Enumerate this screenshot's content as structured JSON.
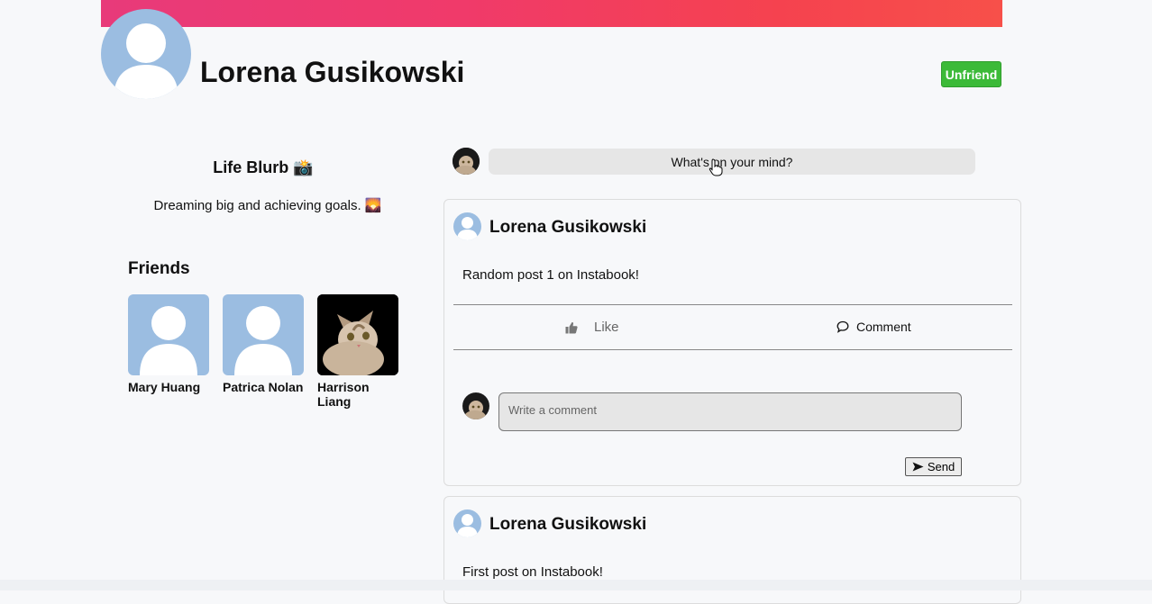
{
  "profile": {
    "name": "Lorena Gusikowski",
    "unfriend_label": "Unfriend"
  },
  "about": {
    "title": "Life Blurb 📸",
    "text": "Dreaming big and achieving goals. 🌄"
  },
  "friends": {
    "title": "Friends",
    "items": [
      {
        "name": "Mary Huang",
        "avatar": "default-person-icon"
      },
      {
        "name": "Patrica Nolan",
        "avatar": "default-person-icon"
      },
      {
        "name": "Harrison Liang",
        "avatar": "cat-photo"
      }
    ]
  },
  "composer": {
    "placeholder": "What's on your mind?"
  },
  "posts": [
    {
      "author": "Lorena Gusikowski",
      "text": "Random post 1 on Instabook!",
      "like_label": "Like",
      "comment_label": "Comment",
      "comment_placeholder": "Write a comment",
      "send_label": "Send"
    },
    {
      "author": "Lorena Gusikowski",
      "text": "First post on Instabook!"
    }
  ],
  "colors": {
    "accent_green": "#3cba38",
    "banner_pink": "#e83a7a",
    "banner_red": "#f7504a",
    "avatar_blue": "#9bbde1"
  }
}
